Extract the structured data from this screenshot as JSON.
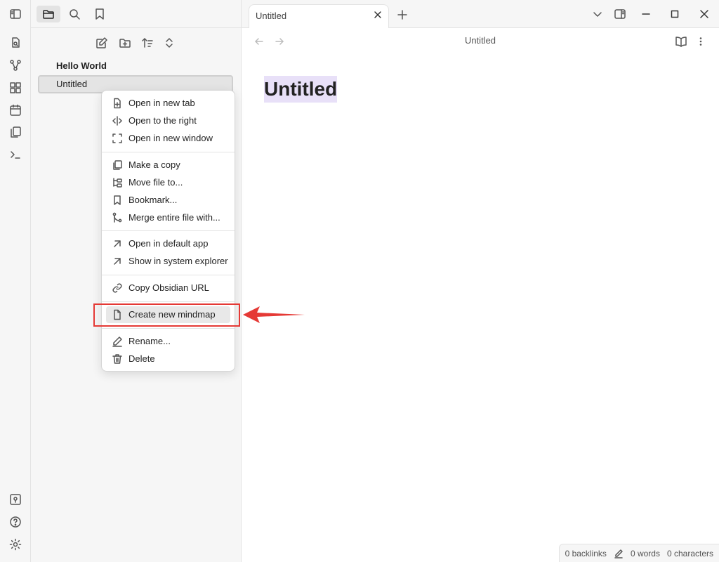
{
  "sidebar": {
    "folder_label": "Hello World",
    "file_label": "Untitled"
  },
  "tab": {
    "title": "Untitled"
  },
  "view": {
    "title": "Untitled"
  },
  "document": {
    "heading": "Untitled"
  },
  "context_menu": {
    "items": [
      {
        "label": "Open in new tab",
        "icon": "file-plus-icon"
      },
      {
        "label": "Open to the right",
        "icon": "split-icon"
      },
      {
        "label": "Open in new window",
        "icon": "maximize-icon"
      },
      {
        "label": "Make a copy",
        "icon": "copy-icon"
      },
      {
        "label": "Move file to...",
        "icon": "folder-tree-icon"
      },
      {
        "label": "Bookmark...",
        "icon": "bookmark-icon"
      },
      {
        "label": "Merge entire file with...",
        "icon": "git-merge-icon"
      },
      {
        "label": "Open in default app",
        "icon": "arrow-up-right-icon"
      },
      {
        "label": "Show in system explorer",
        "icon": "arrow-up-right-icon"
      },
      {
        "label": "Copy Obsidian URL",
        "icon": "link-icon"
      },
      {
        "label": "Create new mindmap",
        "icon": "file-icon"
      },
      {
        "label": "Rename...",
        "icon": "pencil-icon"
      },
      {
        "label": "Delete",
        "icon": "trash-icon"
      }
    ]
  },
  "status": {
    "backlinks": "0 backlinks",
    "words": "0 words",
    "characters": "0 characters"
  },
  "colors": {
    "highlight": "#e53935",
    "title_highlight": "#e8e0f8"
  }
}
